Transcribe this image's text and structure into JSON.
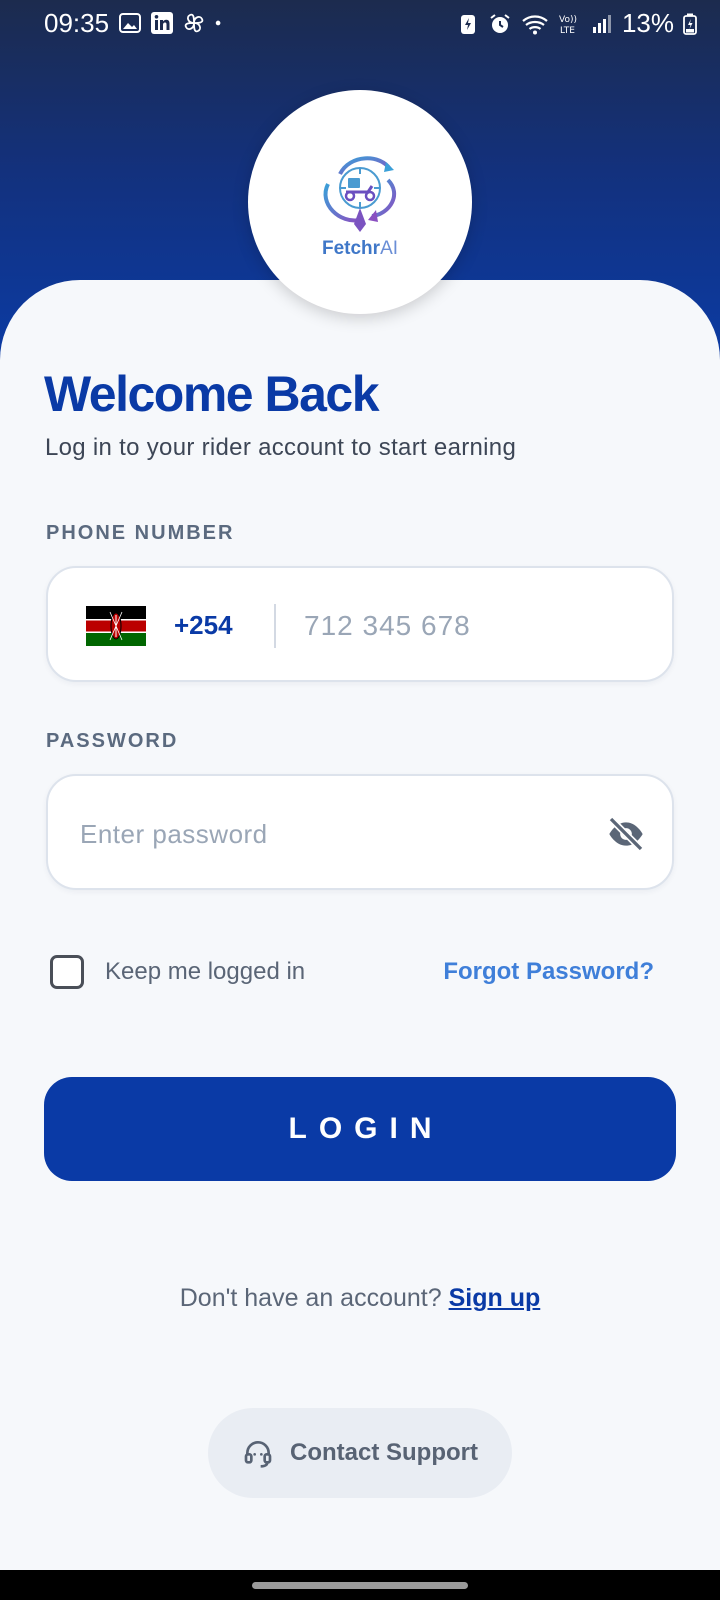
{
  "status_bar": {
    "time": "09:35",
    "battery": "13%",
    "icons": [
      "gallery-icon",
      "linkedin-icon",
      "pinwheel-icon",
      "dot-icon",
      "battery-saver-icon",
      "alarm-icon",
      "wifi-icon",
      "volte-icon",
      "signal-icon",
      "battery-icon"
    ]
  },
  "logo": {
    "brand_part1": "Fetchr",
    "brand_part2": "AI"
  },
  "header": {
    "title": "Welcome Back",
    "subtitle": "Log in to your rider account to start earning"
  },
  "phone": {
    "label": "PHONE NUMBER",
    "country_code": "+254",
    "flag": "kenya-flag-icon",
    "placeholder": "712 345 678",
    "value": ""
  },
  "password": {
    "label": "PASSWORD",
    "placeholder": "Enter password",
    "value": "",
    "toggle_icon": "eye-off-icon"
  },
  "options": {
    "keep_logged_in": "Keep me logged in",
    "keep_logged_in_checked": false,
    "forgot_password": "Forgot Password?"
  },
  "login_button": "LOGIN",
  "signup": {
    "prompt": "Don't have an account?",
    "link": "Sign up"
  },
  "support": {
    "label": "Contact Support",
    "icon": "headset-icon"
  },
  "colors": {
    "primary": "#0a3aa6",
    "link": "#3f7fd9",
    "background": "#f6f8fb"
  }
}
